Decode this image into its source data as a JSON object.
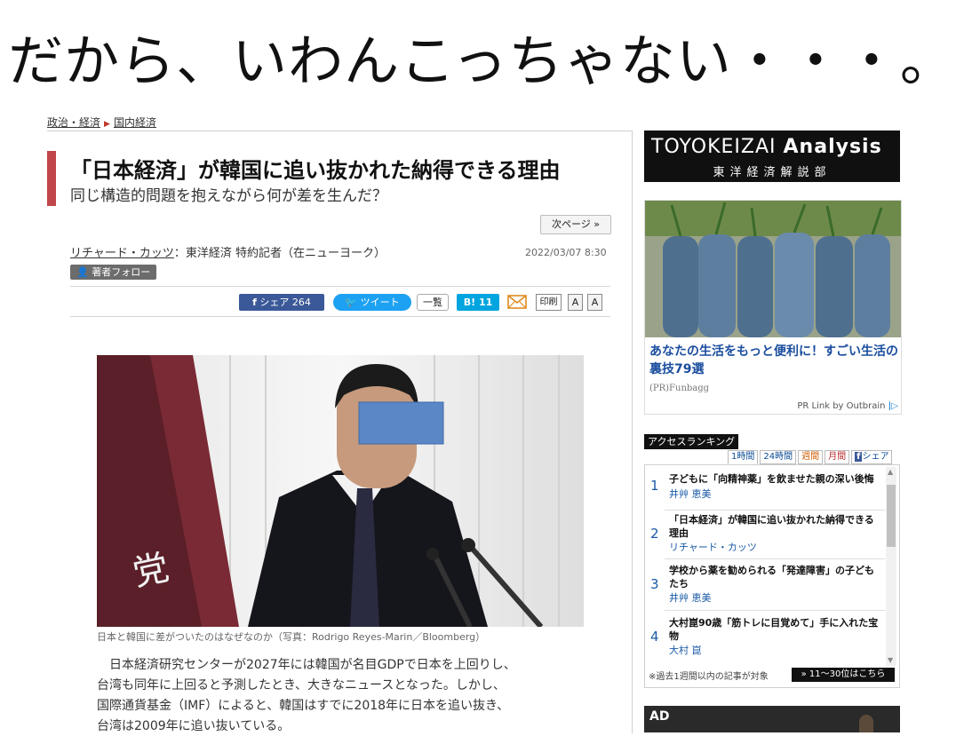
{
  "banner": "だから、いわんこっちゃない・・・。",
  "breadcrumb": {
    "item1": "政治・経済",
    "item2": "国内経済"
  },
  "article": {
    "title": "「日本経済」が韓国に追い抜かれた納得できる理由",
    "subtitle": "同じ構造的問題を抱えながら何が差を生んだ？",
    "next_page": "次ページ »",
    "author_name": "リチャード・カッツ",
    "author_role": "：東洋経済 特約記者（在ニューヨーク）",
    "date": "2022/03/07 8:30",
    "follow": "著者フォロー",
    "share": "シェア 264",
    "tweet": "ツイート",
    "ichiran": "一覧",
    "hatena": "B! 11",
    "print": "印刷",
    "font_a1": "A",
    "font_a2": "A",
    "photo_label": "党",
    "caption": "日本と韓国に差がついたのはなぜなのか（写真：Rodrigo Reyes-Marin／Bloomberg）",
    "body": [
      "日本経済研究センターが2027年には韓国が名目GDPで日本を上回りし、",
      "台湾も同年に上回ると予測したとき、大きなニュースとなった。しかし、",
      "国際通貨基金（IMF）によると、韓国はすでに2018年に日本を追い抜き、",
      "台湾は2009年に追い抜いている。"
    ]
  },
  "sidebar": {
    "brand_main": "TOYOKEIZAI",
    "brand_bold": "Analysis",
    "brand_sub": "東洋経済解説部",
    "ad_text": "あなたの生活をもっと便利に！すごい生活の裏技79選",
    "ad_source": "(PR)Funbagg",
    "ad_link": "PR Link by Outbrain",
    "ranking_title": "アクセスランキング",
    "tabs": [
      "1時間",
      "24時間",
      "週間",
      "月間",
      "シェア"
    ],
    "ranks": [
      {
        "num": "1",
        "title": "子どもに「向精神薬」を飲ませた親の深い後悔",
        "author": "井艸 恵美"
      },
      {
        "num": "2",
        "title": "「日本経済」が韓国に追い抜かれた納得できる理由",
        "author": "リチャード・カッツ"
      },
      {
        "num": "3",
        "title": "学校から薬を勧められる「発達障害」の子どもたち",
        "author": "井艸 恵美"
      },
      {
        "num": "4",
        "title": "大村崑90歳「筋トレに目覚めて」手に入れた宝物",
        "author": "大村 崑"
      }
    ],
    "note": "※過去1週間以内の記事が対象",
    "more": "» 11〜30位はこちら",
    "ad_label": "AD"
  },
  "colors": {
    "accent": "#c0464b",
    "link_blue": "#1a5aa6",
    "facebook": "#3b5998",
    "twitter": "#1da1f2",
    "hatena": "#00a4de"
  }
}
